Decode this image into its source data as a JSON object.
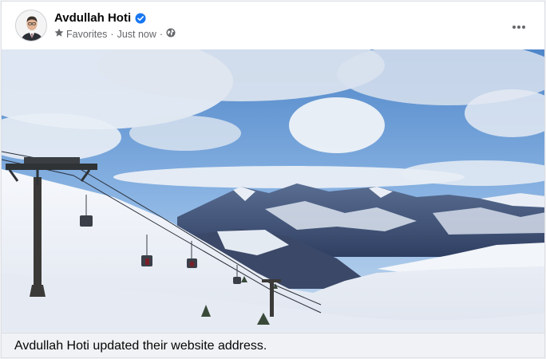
{
  "post": {
    "author_name": "Avdullah Hoti",
    "audience_label": "Favorites",
    "timestamp": "Just now",
    "separator": "·",
    "caption": "Avdullah Hoti updated their website address."
  },
  "icons": {
    "verified": "verified-badge-icon",
    "favorites": "star-icon",
    "privacy": "globe-icon",
    "more": "more-options-icon"
  },
  "colors": {
    "verified_blue": "#1877f2",
    "secondary_text": "#65676b",
    "primary_text": "#050505"
  }
}
